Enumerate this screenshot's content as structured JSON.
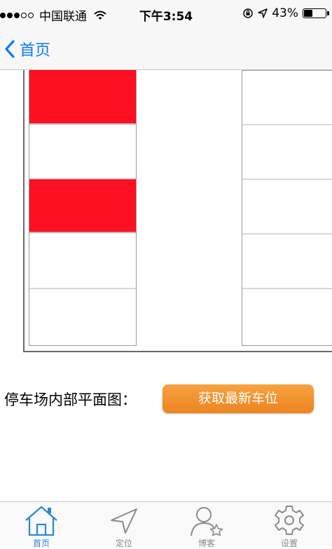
{
  "status_bar": {
    "carrier": "中国联通",
    "time": "下午3:54",
    "battery": "43%",
    "battery_level": 0.43
  },
  "nav": {
    "back_label": "首页"
  },
  "floor_plan": {
    "left_column": [
      "occupied",
      "free",
      "occupied",
      "free",
      "free"
    ],
    "right_column": [
      "free",
      "free",
      "free",
      "free",
      "free"
    ],
    "occupied_color": "#fc1021"
  },
  "legend": {
    "label": "停车场内部平面图：",
    "refresh_button": "获取最新车位"
  },
  "tabs": [
    {
      "label": "首页",
      "icon": "home-icon",
      "active": true
    },
    {
      "label": "定位",
      "icon": "location-arrow-icon",
      "active": false
    },
    {
      "label": "博客",
      "icon": "person-star-icon",
      "active": false
    },
    {
      "label": "设置",
      "icon": "gear-icon",
      "active": false
    }
  ],
  "colors": {
    "accent": "#0a7aff",
    "button": "#f29030",
    "tab_active": "#2a86d8"
  }
}
